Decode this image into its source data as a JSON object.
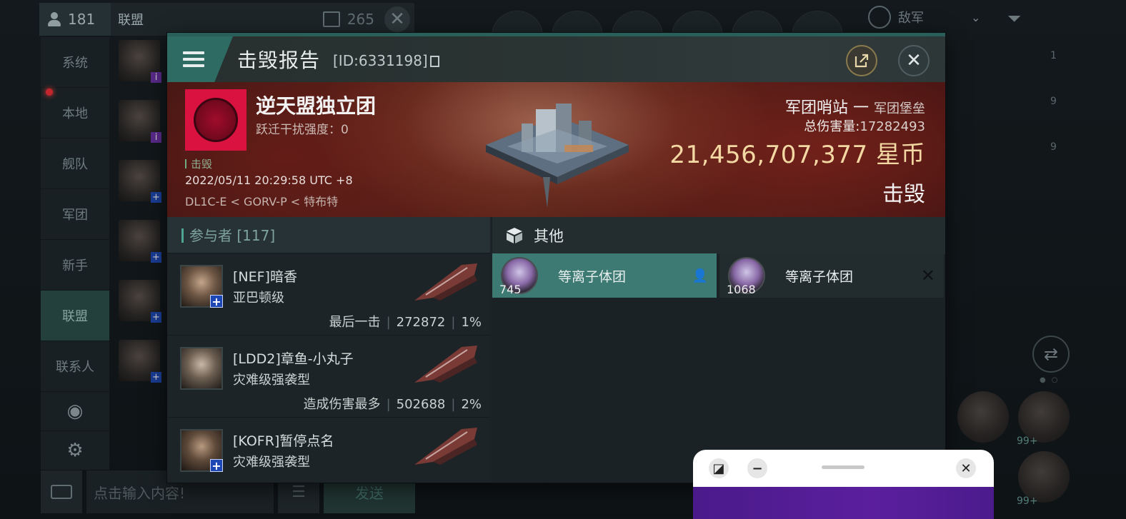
{
  "background": {
    "online_count": "181",
    "channel_title": "联盟",
    "unread_count": "265",
    "tabs": [
      "系统",
      "本地",
      "舰队",
      "军团",
      "新手",
      "联盟",
      "联系人"
    ],
    "active_tab": "联盟",
    "input_placeholder": "点击输入内容!",
    "send_label": "发送",
    "filter_label": "敌军",
    "side_counts": [
      "1",
      "9",
      "9"
    ],
    "module_counts": [
      "99+",
      "99+"
    ]
  },
  "report": {
    "title": "击毁报告",
    "id": "[ID:6331198]",
    "victim": {
      "name": "逆天盟独立团",
      "warp_label": "跃迁干扰强度：",
      "warp_value": "0",
      "kill_tag": "击毁",
      "time": "2022/05/11 20:29:58 UTC +8",
      "location": "DL1C-E < GORV-P < 特布特"
    },
    "structure": {
      "type": "军团哨站 一",
      "subtype": "军团堡垒",
      "damage_label": "总伤害量:",
      "damage_value": "17282493",
      "isk_value": "21,456,707,377",
      "isk_unit": "星币",
      "status": "击毁"
    },
    "participants": {
      "header": "参与者 [117]",
      "rows": [
        {
          "name": "[NEF]暗香",
          "ship": "亚巴顿级",
          "role": "最后一击",
          "damage": "272872",
          "percent": "1%"
        },
        {
          "name": "[LDD2]章鱼-小丸子",
          "ship": "灾难级强袭型",
          "role": "造成伤害最多",
          "damage": "502688",
          "percent": "2%"
        },
        {
          "name": "[KOFR]暂停点名",
          "ship": "灾难级强袭型",
          "role": "",
          "damage": "",
          "percent": ""
        }
      ]
    },
    "other": {
      "header": "其他",
      "items": [
        {
          "name": "等离子体团",
          "qty": "745",
          "state": "dropped"
        },
        {
          "name": "等离子体团",
          "qty": "1068",
          "state": "destroyed"
        }
      ]
    }
  },
  "colors": {
    "accent_teal": "#2d6b63",
    "isk_gold": "#f3d8a3",
    "corp_red": "#d9123f",
    "banner_red": "#5a2219"
  }
}
